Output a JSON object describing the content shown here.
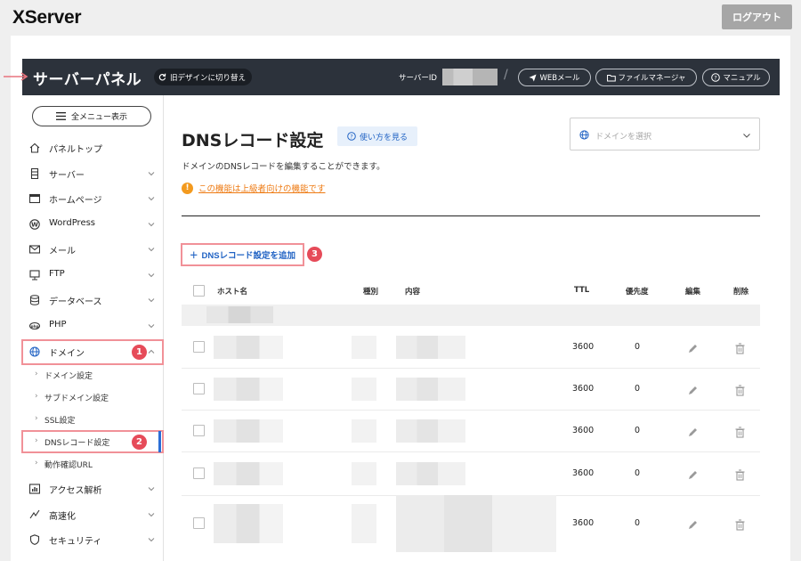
{
  "app": {
    "logo": "XServer",
    "logout_label": "ログアウト"
  },
  "header": {
    "panel_title": "サーバーパネル",
    "old_design_label": "旧デザインに切り替え",
    "server_id_label": "サーバーID",
    "webmail_label": "WEBメール",
    "file_manager_label": "ファイルマネージャ",
    "manual_label": "マニュアル"
  },
  "sidebar": {
    "all_menu_label": "全メニュー表示",
    "items": [
      {
        "label": "パネルトップ",
        "icon": "home-icon",
        "has_chevron": false
      },
      {
        "label": "サーバー",
        "icon": "server-icon",
        "has_chevron": true
      },
      {
        "label": "ホームページ",
        "icon": "window-icon",
        "has_chevron": true
      },
      {
        "label": "WordPress",
        "icon": "wordpress-icon",
        "has_chevron": true
      },
      {
        "label": "メール",
        "icon": "mail-icon",
        "has_chevron": true
      },
      {
        "label": "FTP",
        "icon": "monitor-icon",
        "has_chevron": true
      },
      {
        "label": "データベース",
        "icon": "database-icon",
        "has_chevron": true
      },
      {
        "label": "PHP",
        "icon": "php-icon",
        "has_chevron": true
      },
      {
        "label": "ドメイン",
        "icon": "globe-icon",
        "has_chevron": true,
        "expanded": true
      }
    ],
    "domain_sub_items": [
      {
        "label": "ドメイン設定"
      },
      {
        "label": "サブドメイン設定"
      },
      {
        "label": "SSL設定"
      },
      {
        "label": "DNSレコード設定",
        "active": true
      },
      {
        "label": "動作確認URL"
      }
    ],
    "items_after": [
      {
        "label": "アクセス解析",
        "icon": "chart-icon",
        "has_chevron": true
      },
      {
        "label": "高速化",
        "icon": "speed-icon",
        "has_chevron": true
      },
      {
        "label": "セキュリティ",
        "icon": "shield-icon",
        "has_chevron": true
      }
    ]
  },
  "annotations": {
    "badge_1": "1",
    "badge_2": "2",
    "badge_3": "3",
    "accent": "#e64b59"
  },
  "main": {
    "title": "DNSレコード設定",
    "howto_label": "使い方を見る",
    "domain_select_placeholder": "ドメインを選択",
    "description": "ドメインのDNSレコードを編集することができます。",
    "warning_text": "この機能は上級者向けの機能です",
    "add_button_label": "DNSレコード設定を追加",
    "table": {
      "headers": {
        "host": "ホスト名",
        "type": "種別",
        "content": "内容",
        "ttl": "TTL",
        "priority": "優先度",
        "edit": "編集",
        "delete": "削除"
      },
      "rows": [
        {
          "ttl": "3600",
          "priority": "0"
        },
        {
          "ttl": "3600",
          "priority": "0"
        },
        {
          "ttl": "3600",
          "priority": "0"
        },
        {
          "ttl": "3600",
          "priority": "0"
        },
        {
          "ttl": "3600",
          "priority": "0"
        }
      ]
    }
  },
  "colors": {
    "header_bg": "#2c323b",
    "link_blue": "#2163c4",
    "warning_orange": "#ee7a12",
    "highlight_border": "#f19198"
  }
}
